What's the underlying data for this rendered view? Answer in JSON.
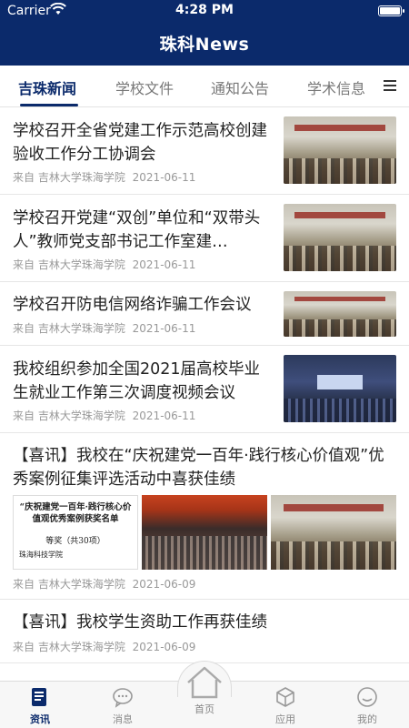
{
  "status_bar": {
    "carrier": "Carrier",
    "time": "4:28 PM"
  },
  "app": {
    "title": "珠科News"
  },
  "tabs": [
    {
      "label": "吉珠新闻",
      "active": true
    },
    {
      "label": "学校文件"
    },
    {
      "label": "通知公告"
    },
    {
      "label": "学术信息"
    }
  ],
  "news": [
    {
      "title": "学校召开全省党建工作示范高校创建验收工作分工协调会",
      "source": "来自 吉林大学珠海学院",
      "date": "2021-06-11"
    },
    {
      "title": "学校召开党建“双创”单位和“双带头人”教师党支部书记工作室建…",
      "source": "来自 吉林大学珠海学院",
      "date": "2021-06-11"
    },
    {
      "title": "学校召开防电信网络诈骗工作会议",
      "source": "来自 吉林大学珠海学院",
      "date": "2021-06-11"
    },
    {
      "title": "我校组织参加全国2021届高校毕业生就业工作第三次调度视频会议",
      "source": "来自 吉林大学珠海学院",
      "date": "2021-06-11"
    },
    {
      "title": "【喜讯】我校在“庆祝建党一百年·践行核心价值观”优秀案例征集评选活动中喜获佳绩",
      "source": "来自 吉林大学珠海学院",
      "date": "2021-06-09",
      "doc_image": {
        "heading": "“庆祝建党一百年·践行核心价值观优秀案例获奖名单",
        "prize": "等奖（共30项）",
        "school": "珠海科技学院"
      }
    },
    {
      "title": "【喜讯】我校学生资助工作再获佳绩",
      "source": "来自 吉林大学珠海学院",
      "date": "2021-06-09"
    }
  ],
  "bottom_tabs": [
    {
      "label": "资讯",
      "icon": "news-icon",
      "active": true
    },
    {
      "label": "消息",
      "icon": "message-icon"
    },
    {
      "label": "首页",
      "icon": "home-icon"
    },
    {
      "label": "应用",
      "icon": "apps-icon"
    },
    {
      "label": "我的",
      "icon": "profile-icon"
    }
  ],
  "colors": {
    "primary": "#0b2a6b",
    "inactive": "#888888"
  }
}
